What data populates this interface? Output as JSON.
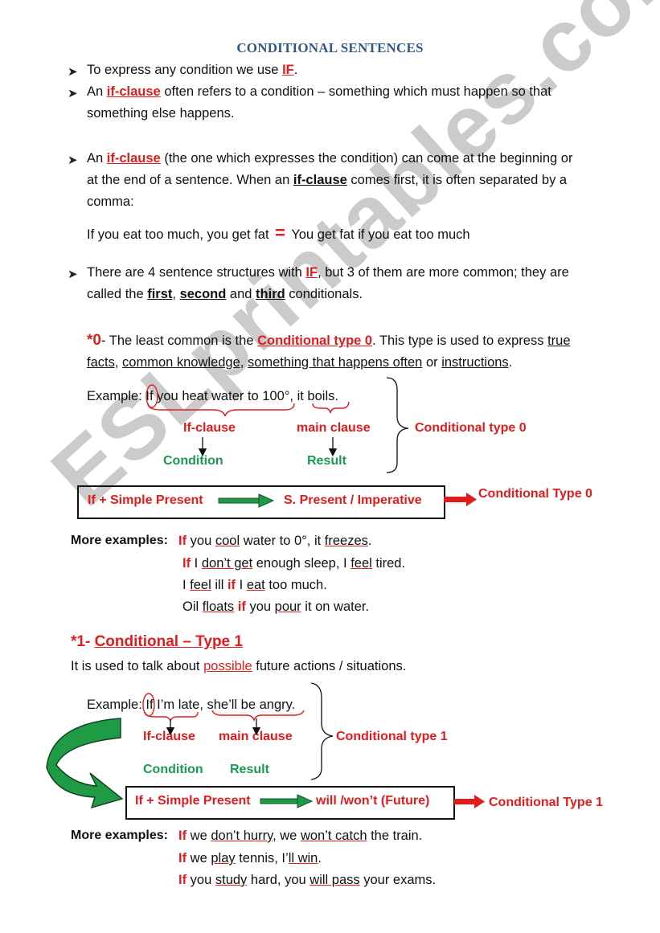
{
  "title": "CONDITIONAL SENTENCES",
  "bullets": [
    {
      "pre": "To express any condition we use ",
      "key": "IF",
      "post": "."
    },
    {
      "pre": "An ",
      "key": "if-clause",
      "post": " often refers to a condition – something which must happen so that",
      "line2": "something else happens."
    },
    {
      "pre": "An ",
      "key": "if-clause",
      "post": " (the one which expresses the condition) can come at the beginning or",
      "line2_pre": "at the end of a sentence. When an ",
      "line2_key": "if-clause",
      "line2_post": " comes first, it is often separated by a",
      "line3": "comma:"
    },
    {
      "pre": "There are 4 sentence structures with ",
      "key": "IF",
      "post": ", but 3 of them are more common; they are",
      "line2_pre": "called the ",
      "w1": "first",
      "sep1": ", ",
      "w2": "second",
      "sep2": " and ",
      "w3": "third",
      "line2_post": " conditionals."
    }
  ],
  "equivalence": {
    "left": "If you eat too much, you get fat",
    "sign": "=",
    "right": "You get fat if you eat too much"
  },
  "type0": {
    "marker": "*0",
    "intro_pre": "- The least common is the ",
    "intro_key": "Conditional type 0",
    "intro_post": ". This type is used to express ",
    "u1": "true",
    "u1b": "facts",
    "sep1": ", ",
    "u2": "common knowledge",
    "sep2": ", ",
    "u3": "something that happens often",
    "sep3": " or ",
    "u4": "instructions",
    "end": ".",
    "example_label": "Example: ",
    "example_if": "If",
    "example_rest1": " you heat water to 100°",
    "example_comma": ", ",
    "example_rest2": "it boils.",
    "if_clause_label": "If-clause",
    "main_clause_label": "main clause",
    "condition_label": "Condition",
    "result_label": "Result",
    "brace_label": "Conditional type 0",
    "formula_left": "If + Simple Present",
    "formula_right": "S. Present / Imperative",
    "formula_tag": "Conditional Type 0",
    "more_label": "More examples: ",
    "examples": [
      [
        {
          "t": "If",
          "c": "red"
        },
        {
          "t": " you "
        },
        {
          "t": "cool",
          "c": "ured"
        },
        {
          "t": " water to 0°, it "
        },
        {
          "t": "freezes",
          "c": "ured"
        },
        {
          "t": "."
        }
      ],
      [
        {
          "t": "If",
          "c": "red"
        },
        {
          "t": " I "
        },
        {
          "t": "don’t get",
          "c": "ured"
        },
        {
          "t": " enough sleep, I "
        },
        {
          "t": "feel",
          "c": "ured"
        },
        {
          "t": " tired."
        }
      ],
      [
        {
          "t": "I "
        },
        {
          "t": "feel",
          "c": "ured"
        },
        {
          "t": " ill "
        },
        {
          "t": "if",
          "c": "red"
        },
        {
          "t": " I "
        },
        {
          "t": "eat",
          "c": "ured"
        },
        {
          "t": " too much."
        }
      ],
      [
        {
          "t": "Oil "
        },
        {
          "t": "floats",
          "c": "ured"
        },
        {
          "t": " "
        },
        {
          "t": "if",
          "c": "red"
        },
        {
          "t": " you "
        },
        {
          "t": "pour",
          "c": "ured"
        },
        {
          "t": " it on water."
        }
      ]
    ]
  },
  "type1": {
    "heading_marker": "*1- ",
    "heading": "Conditional – Type 1",
    "desc_pre": "It is used to talk about ",
    "desc_key": "possible",
    "desc_post": " future actions / situations.",
    "example_label": "Example: ",
    "example_if": "If",
    "example_rest1": " I’m late",
    "example_comma": ", ",
    "example_rest2": "she’ll be angry.",
    "if_clause_label": "If-clause",
    "main_clause_label": "main clause",
    "condition_label": "Condition",
    "result_label": "Result",
    "brace_label": "Conditional type 1",
    "formula_left": "If + Simple Present",
    "formula_right": "will /won’t (Future)",
    "formula_tag": "Conditional Type 1",
    "more_label": "More examples: ",
    "examples": [
      [
        {
          "t": "If",
          "c": "red"
        },
        {
          "t": " we "
        },
        {
          "t": "don’t hurry",
          "c": "ured"
        },
        {
          "t": ", we "
        },
        {
          "t": "won’t catch",
          "c": "ured"
        },
        {
          "t": " the train."
        }
      ],
      [
        {
          "t": "If",
          "c": "red"
        },
        {
          "t": " we "
        },
        {
          "t": "play",
          "c": "ured"
        },
        {
          "t": " tennis, I’"
        },
        {
          "t": "ll win",
          "c": "ured"
        },
        {
          "t": "."
        }
      ],
      [
        {
          "t": "If",
          "c": "red"
        },
        {
          "t": " you "
        },
        {
          "t": "study",
          "c": "ured"
        },
        {
          "t": " hard, you "
        },
        {
          "t": "will pass",
          "c": "ured"
        },
        {
          "t": " your exams."
        }
      ]
    ]
  },
  "watermark": "ESLprintables.com",
  "colors": {
    "title": "#2e5a8a",
    "red": "#e21c1c",
    "green": "#1a9a4c",
    "arrow_green": "#1f9b46"
  }
}
